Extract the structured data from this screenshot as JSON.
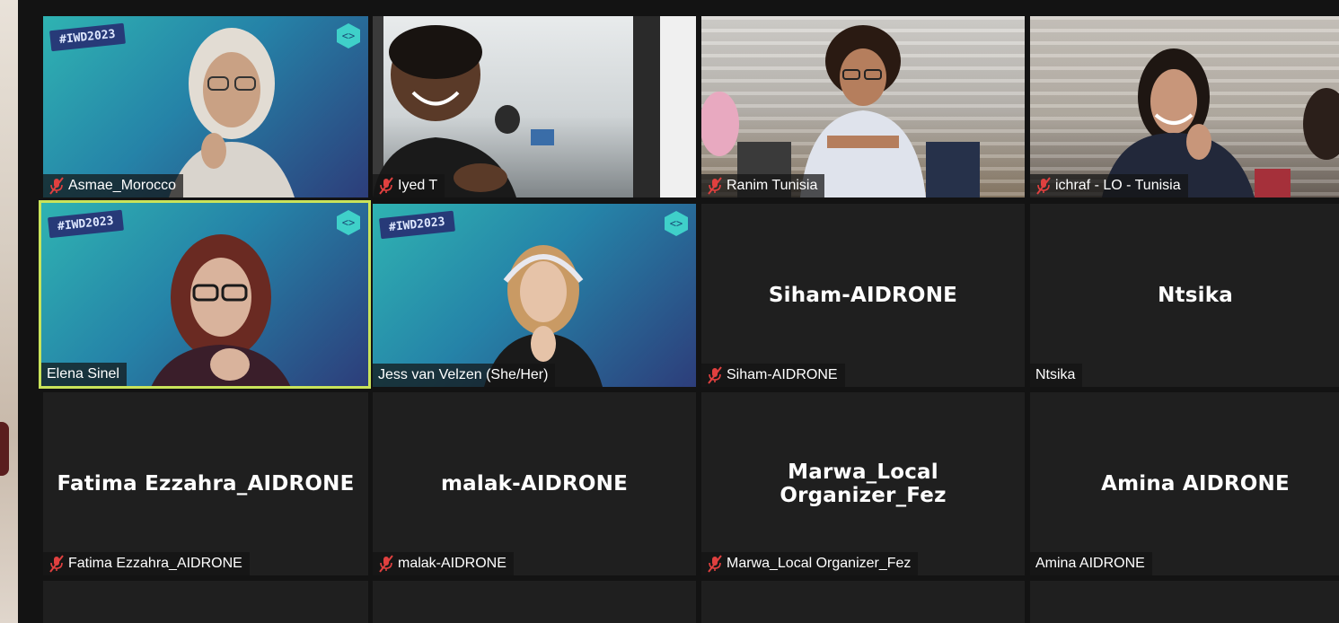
{
  "meeting": {
    "participants": [
      {
        "display_name": "Asmae_Morocco",
        "muted": true,
        "video": "iwd-background",
        "center_label": ""
      },
      {
        "display_name": "Iyed T",
        "muted": true,
        "video": "office",
        "center_label": ""
      },
      {
        "display_name": "Ranim Tunisia",
        "muted": true,
        "video": "room",
        "center_label": ""
      },
      {
        "display_name": "ichraf - LO - Tunisia",
        "muted": true,
        "video": "room",
        "center_label": ""
      },
      {
        "display_name": "Elena Sinel",
        "muted": false,
        "video": "iwd-background",
        "active_speaker": true,
        "center_label": ""
      },
      {
        "display_name": "Jess van Velzen (She/Her)",
        "muted": false,
        "video": "iwd-background",
        "center_label": ""
      },
      {
        "display_name": "Siham-AIDRONE",
        "muted": true,
        "video": "off",
        "center_label": "Siham-AIDRONE"
      },
      {
        "display_name": "Ntsika",
        "muted": false,
        "video": "off",
        "center_label": "Ntsika"
      },
      {
        "display_name": "Fatima Ezzahra_AIDRONE",
        "muted": true,
        "video": "off",
        "center_label": "Fatima Ezzahra_AIDRONE"
      },
      {
        "display_name": "malak-AIDRONE",
        "muted": true,
        "video": "off",
        "center_label": "malak-AIDRONE"
      },
      {
        "display_name": "Marwa_Local Organizer_Fez",
        "muted": true,
        "video": "off",
        "center_label": "Marwa_Local Organizer_Fez"
      },
      {
        "display_name": "Amina AIDRONE",
        "muted": false,
        "video": "off",
        "center_label": "Amina AIDRONE"
      }
    ],
    "background_tag": "#IWD2023"
  },
  "colors": {
    "active_speaker_border": "#c9e35a",
    "muted_icon": "#e0403f",
    "tile_background": "#1f1f1f",
    "gallery_background": "#131313"
  },
  "icons": {
    "muted": "microphone-muted-icon",
    "brand": "hexagon-code-icon"
  }
}
